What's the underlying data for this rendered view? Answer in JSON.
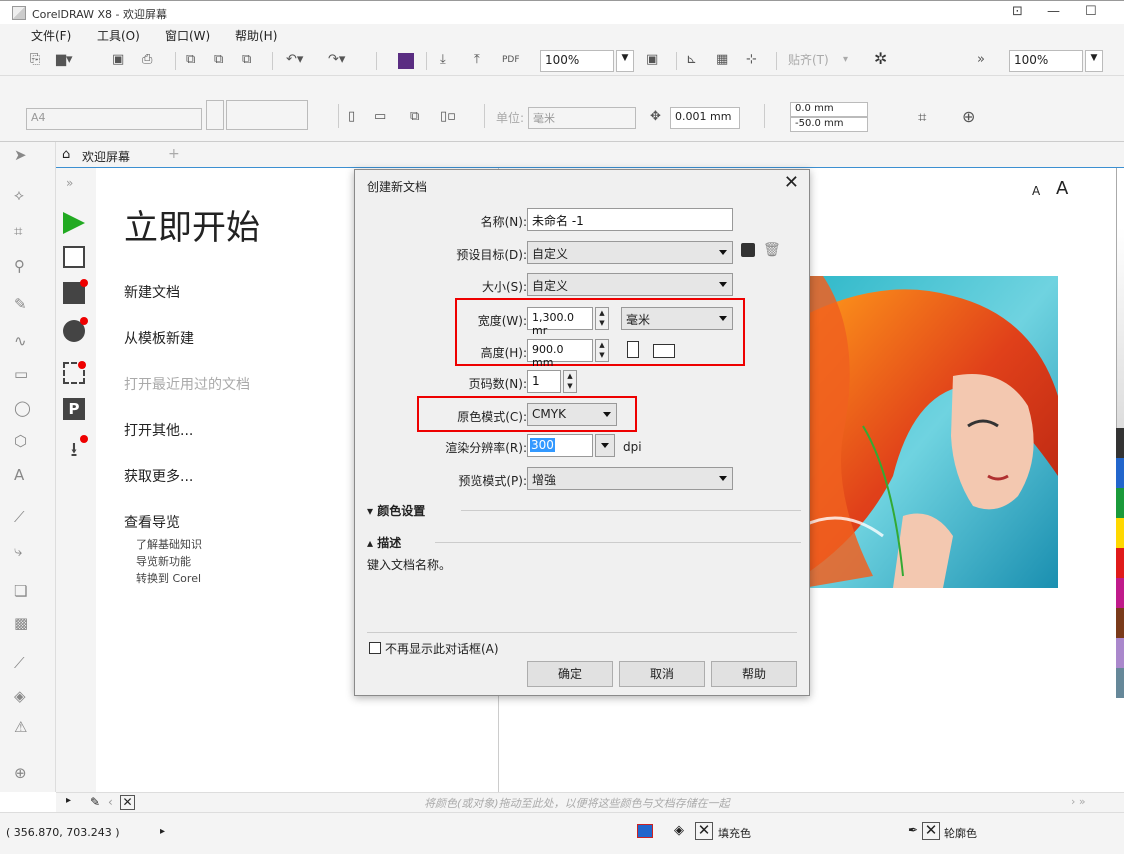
{
  "window": {
    "title": "CorelDRAW X8 - 欢迎屏幕"
  },
  "menubar": [
    "文件(F)",
    "工具(O)",
    "窗口(W)",
    "帮助(H)"
  ],
  "toolbar1": {
    "zoom": "100%",
    "snap": "贴齐(T)",
    "zoom_right": "100%"
  },
  "toolbar2": {
    "page_size": "A4",
    "unit_label": "单位:",
    "unit_value": "毫米",
    "nudge": "0.001 mm",
    "dup_x": "0.0 mm",
    "dup_y": "-50.0 mm"
  },
  "tab": {
    "label": "欢迎屏幕"
  },
  "welcome": {
    "heading": "立即开始",
    "links": [
      "新建文档",
      "从模板新建",
      "打开最近用过的文档",
      "打开其他...",
      "获取更多...",
      "查看导览"
    ],
    "sublinks": [
      "了解基础知识",
      "导览新功能",
      "转换到 Corel"
    ],
    "font_size_small": "A",
    "font_size_large": "A"
  },
  "dialog": {
    "title": "创建新文档",
    "close": "✕",
    "name_label": "名称(N):",
    "name_value": "未命名 -1",
    "preset_label": "预设目标(D):",
    "preset_value": "自定义",
    "size_label": "大小(S):",
    "size_value": "自定义",
    "width_label": "宽度(W):",
    "width_value": "1,300.0 mr",
    "unit_value": "毫米",
    "height_label": "高度(H):",
    "height_value": "900.0 mm",
    "pages_label": "页码数(N):",
    "pages_value": "1",
    "color_mode_label": "原色模式(C):",
    "color_mode_value": "CMYK",
    "resolution_label": "渲染分辨率(R):",
    "resolution_value": "300",
    "resolution_unit": "dpi",
    "preview_label": "预览模式(P):",
    "preview_value": "增強",
    "color_settings": "颜色设置",
    "description": "描述",
    "description_text": "键入文档名称。",
    "dont_show": "不再显示此对话框(A)",
    "ok": "确定",
    "cancel": "取消",
    "help": "帮助"
  },
  "statusbar": {
    "hint": "将颜色(或对象)拖动至此处，以便将这些颜色与文档存储在一起"
  },
  "bottombar": {
    "coords": "( 356.870, 703.243 )",
    "fill": "填充色",
    "outline": "轮廓色"
  },
  "colors": {
    "accent": "#3b8fd1",
    "highlight": "#e00000",
    "selected": "#3399ff"
  }
}
